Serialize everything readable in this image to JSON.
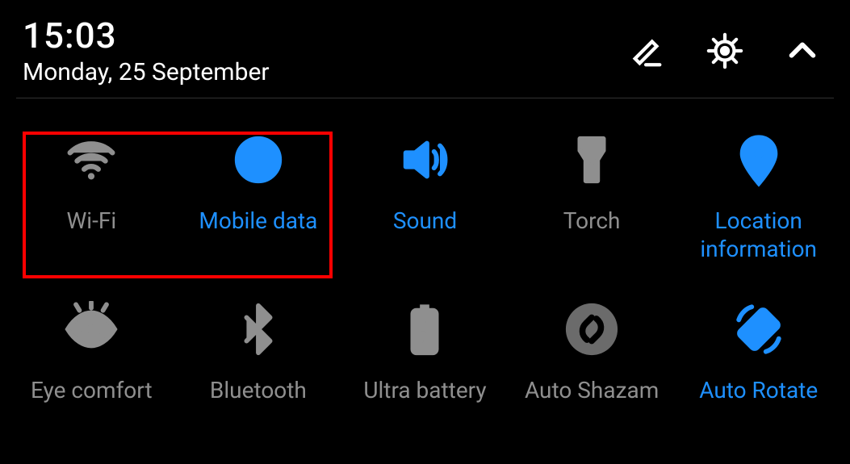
{
  "header": {
    "time": "15:03",
    "date": "Monday, 25 September"
  },
  "tiles": {
    "wifi": {
      "label": "Wi-Fi"
    },
    "mobile_data": {
      "label": "Mobile data"
    },
    "sound": {
      "label": "Sound"
    },
    "torch": {
      "label": "Torch"
    },
    "location": {
      "label": "Location information"
    },
    "eye_comfort": {
      "label": "Eye comfort"
    },
    "bluetooth": {
      "label": "Bluetooth"
    },
    "ultra_batt": {
      "label": "Ultra battery"
    },
    "auto_shazam": {
      "label": "Auto Shazam"
    },
    "auto_rotate": {
      "label": "Auto Rotate"
    }
  }
}
